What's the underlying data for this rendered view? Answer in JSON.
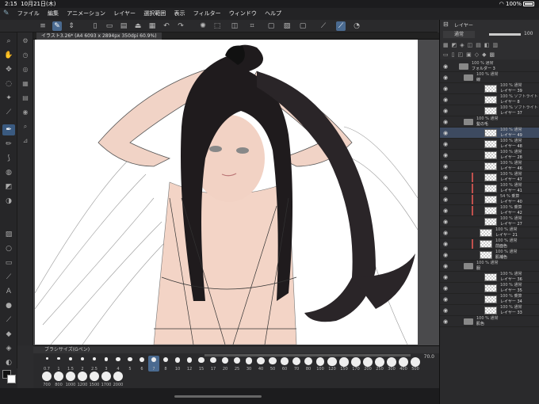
{
  "status": {
    "time": "2:15",
    "date": "10月21日(木)",
    "battery": "100%"
  },
  "menu": [
    "ファイル",
    "編集",
    "アニメーション",
    "レイヤー",
    "選択範囲",
    "表示",
    "フィルター",
    "ウィンドウ",
    "ヘルプ"
  ],
  "document": {
    "tab_title": "イラスト3.26* (A4 6093 x 2894px 350dpi 60.9%)"
  },
  "brush": {
    "panel_title": "ブラシサイズ(Gペン)",
    "max_value": "70.0",
    "sizes_row1": [
      "0.7",
      "1",
      "1.5",
      "2",
      "2.5",
      "3",
      "4",
      "5",
      "6",
      "7",
      "8",
      "10",
      "12",
      "15",
      "17",
      "20",
      "25",
      "30",
      "40",
      "50",
      "60",
      "70",
      "80",
      "100",
      "120",
      "150",
      "170",
      "200",
      "250",
      "300",
      "400",
      "500"
    ],
    "sizes_row2": [
      "700",
      "800",
      "1000",
      "1200",
      "1500",
      "1700",
      "2000"
    ],
    "selected": "7"
  },
  "layer_panel": {
    "title": "レイヤー",
    "blend": "通常",
    "opacity": "100",
    "layers": [
      {
        "pct": "100 %",
        "mode": "通常",
        "name": "フォルダー 3",
        "type": "folder",
        "indent": 0
      },
      {
        "pct": "100 %",
        "mode": "通常",
        "name": "線",
        "type": "folder",
        "indent": 1
      },
      {
        "pct": "100 %",
        "mode": "通常",
        "name": "レイヤー 39",
        "type": "layer",
        "indent": 2
      },
      {
        "pct": "100 %",
        "mode": "ソフトライト",
        "name": "レイヤー 8",
        "type": "layer",
        "indent": 2
      },
      {
        "pct": "100 %",
        "mode": "ソフトライト",
        "name": "レイヤー 37",
        "type": "layer",
        "indent": 2
      },
      {
        "pct": "100 %",
        "mode": "通常",
        "name": "髪の毛",
        "type": "folder",
        "indent": 1
      },
      {
        "pct": "100 %",
        "mode": "通常",
        "name": "レイヤー 49",
        "type": "layer",
        "indent": 2,
        "selected": true
      },
      {
        "pct": "100 %",
        "mode": "通常",
        "name": "レイヤー 48",
        "type": "layer",
        "indent": 2
      },
      {
        "pct": "100 %",
        "mode": "通常",
        "name": "レイヤー 28",
        "type": "layer",
        "indent": 2
      },
      {
        "pct": "100 %",
        "mode": "通常",
        "name": "レイヤー 46",
        "type": "layer",
        "indent": 2
      },
      {
        "pct": "100 %",
        "mode": "通常",
        "name": "レイヤー 47",
        "type": "layer",
        "indent": 2,
        "clip": true
      },
      {
        "pct": "100 %",
        "mode": "通常",
        "name": "レイヤー 41",
        "type": "layer",
        "indent": 2,
        "clip": true
      },
      {
        "pct": "54 %",
        "mode": "乗算",
        "name": "レイヤー 40",
        "type": "layer",
        "indent": 2,
        "clip": true
      },
      {
        "pct": "100 %",
        "mode": "乗算",
        "name": "レイヤー 42",
        "type": "layer",
        "indent": 2,
        "clip": true
      },
      {
        "pct": "100 %",
        "mode": "通常",
        "name": "レイヤー 27",
        "type": "layer",
        "indent": 2
      },
      {
        "pct": "100 %",
        "mode": "通常",
        "name": "レイヤー 21",
        "type": "layer",
        "indent": 1
      },
      {
        "pct": "100 %",
        "mode": "通常",
        "name": "前面色",
        "type": "layer",
        "indent": 1,
        "clip": true
      },
      {
        "pct": "100 %",
        "mode": "通常",
        "name": "肌補色",
        "type": "layer",
        "indent": 1
      },
      {
        "pct": "100 %",
        "mode": "通常",
        "name": "服",
        "type": "folder",
        "indent": 1
      },
      {
        "pct": "100 %",
        "mode": "通常",
        "name": "レイヤー 36",
        "type": "layer",
        "indent": 2
      },
      {
        "pct": "100 %",
        "mode": "通常",
        "name": "レイヤー 35",
        "type": "layer",
        "indent": 2
      },
      {
        "pct": "100 %",
        "mode": "乗算",
        "name": "レイヤー 34",
        "type": "layer",
        "indent": 2
      },
      {
        "pct": "100 %",
        "mode": "通常",
        "name": "レイヤー 33",
        "type": "layer",
        "indent": 2
      },
      {
        "pct": "100 %",
        "mode": "通常",
        "name": "肌色",
        "type": "folder",
        "indent": 1
      }
    ]
  },
  "colors": {
    "accent": "#4a6a90",
    "hair": "#1f1b1d",
    "skin": "#f2cfbf"
  }
}
